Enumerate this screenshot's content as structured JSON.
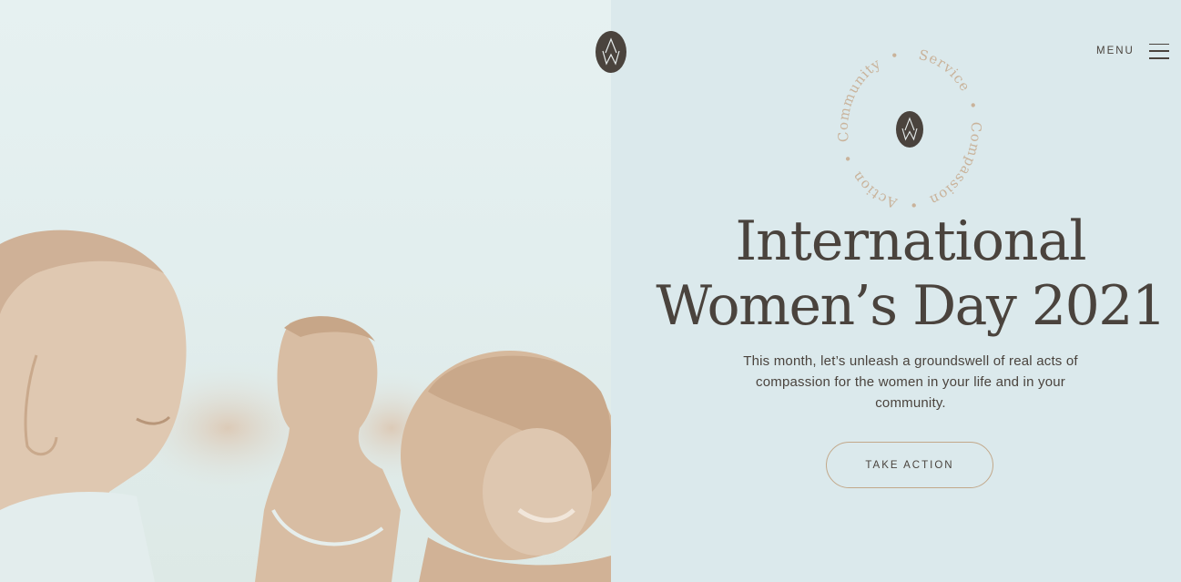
{
  "header": {
    "logo_icon": "aw-monogram-icon",
    "menu_label": "MENU",
    "menu_icon": "hamburger-icon"
  },
  "ring": {
    "words": [
      "Community",
      "Service",
      "Compassion",
      "Action"
    ],
    "separator": "•",
    "center_icon": "aw-monogram-icon"
  },
  "hero": {
    "title_line1": "International",
    "title_line2": "Women’s Day 2021",
    "intro": "This month, let’s unleash a groundswell of real acts of compassion for the women in your life and in your community.",
    "cta_label": "TAKE ACTION"
  },
  "colors": {
    "text": "#4a433d",
    "background": "#dbe9ec",
    "accent_border": "#c2a88a",
    "photo_tint": "#d8bfa6"
  }
}
